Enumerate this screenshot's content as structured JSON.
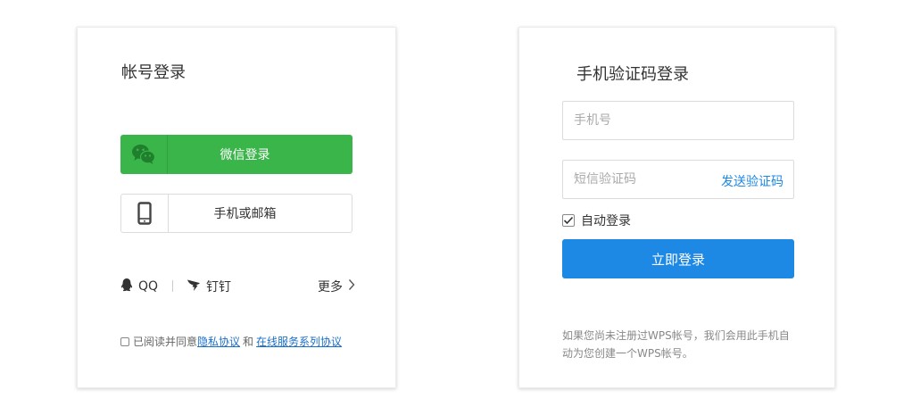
{
  "left_card": {
    "title": "帐号登录",
    "wechat_label": "微信登录",
    "phone_email_label": "手机或邮箱",
    "qq_label": "QQ",
    "dingtalk_label": "钉钉",
    "more_label": "更多",
    "agree_prefix": "已阅读并同意",
    "privacy_link": "隐私协议",
    "and_text": "和",
    "service_link": "在线服务系列协议"
  },
  "right_card": {
    "title": "手机验证码登录",
    "phone_placeholder": "手机号",
    "code_placeholder": "短信验证码",
    "send_code_label": "发送验证码",
    "auto_login_label": "自动登录",
    "auto_login_checked": true,
    "submit_label": "立即登录",
    "notice": "如果您尚未注册过WPS帐号，我们会用此手机自动为您创建一个WPS帐号。"
  },
  "colors": {
    "wechat_green": "#3ab54a",
    "primary_blue": "#1e88e5",
    "link_blue": "#1a6fc8"
  },
  "icons": {
    "wechat": "wechat-icon",
    "phone": "phone-icon",
    "qq": "qq-icon",
    "dingtalk": "dingtalk-icon",
    "more": "chevron-right-icon",
    "check": "check-icon"
  }
}
